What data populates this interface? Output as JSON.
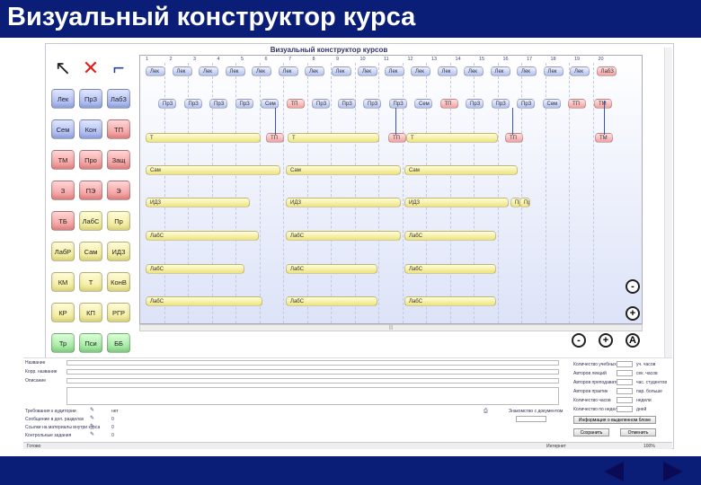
{
  "slide": {
    "title": "Визуальный конструктор курса"
  },
  "window": {
    "title": "Визуальный конструктор курсов"
  },
  "palette": {
    "tools": [
      {
        "icon": "cursor-icon"
      },
      {
        "icon": "delete-x-icon"
      },
      {
        "icon": "link-connector-icon"
      }
    ],
    "rows": [
      [
        {
          "label": "Лек",
          "color": "blue"
        },
        {
          "label": "ПрЗ",
          "color": "blue"
        },
        {
          "label": "ЛабЗ",
          "color": "blue"
        }
      ],
      [
        {
          "label": "Сем",
          "color": "blue"
        },
        {
          "label": "Кон",
          "color": "blue"
        },
        {
          "label": "ТП",
          "color": "red"
        }
      ],
      [
        {
          "label": "ТМ",
          "color": "red"
        },
        {
          "label": "Про",
          "color": "red"
        },
        {
          "label": "Защ",
          "color": "red"
        }
      ],
      [
        {
          "label": "З",
          "color": "red"
        },
        {
          "label": "ПЭ",
          "color": "red"
        },
        {
          "label": "Э",
          "color": "red"
        }
      ],
      [
        {
          "label": "ТБ",
          "color": "red"
        },
        {
          "label": "ЛабС",
          "color": "yellow"
        },
        {
          "label": "Пр",
          "color": "yellow"
        }
      ],
      [
        {
          "label": "ЛабР",
          "color": "yellow"
        },
        {
          "label": "Сам",
          "color": "yellow"
        },
        {
          "label": "ИДЗ",
          "color": "yellow"
        }
      ],
      [
        {
          "label": "КМ",
          "color": "yellow"
        },
        {
          "label": "Т",
          "color": "yellow"
        },
        {
          "label": "КонВ",
          "color": "yellow"
        }
      ],
      [
        {
          "label": "КР",
          "color": "yellow"
        },
        {
          "label": "КП",
          "color": "yellow"
        },
        {
          "label": "РГР",
          "color": "yellow"
        }
      ],
      [
        {
          "label": "Тр",
          "color": "green"
        },
        {
          "label": "Пси",
          "color": "green"
        },
        {
          "label": "ББ",
          "color": "green"
        }
      ]
    ]
  },
  "timeline": {
    "columns": [
      "1",
      "2",
      "3",
      "4",
      "5",
      "6",
      "7",
      "8",
      "9",
      "10",
      "11",
      "12",
      "13",
      "14",
      "15",
      "16",
      "17",
      "18",
      "19",
      "20"
    ],
    "row_lek": [
      "Лек",
      "Лек",
      "Лек",
      "Лек",
      "Лек",
      "Лек",
      "Лек",
      "Лек",
      "Лек",
      "Лек",
      "Лек",
      "Лек",
      "Лек",
      "Лек",
      "Лек",
      "Лек",
      "Лек",
      "ЛабЗ"
    ],
    "row_prz": [
      "ПрЗ",
      "ПрЗ",
      "ПрЗ",
      "ПрЗ",
      "Сем",
      "ТП",
      "ПрЗ",
      "ПрЗ",
      "ПрЗ",
      "ПрЗ",
      "Сем",
      "ТП",
      "ПрЗ",
      "ПрЗ",
      "ПрЗ",
      "Сем",
      "ТП",
      "ТМ"
    ],
    "row_t": [
      "Т",
      "ТП",
      "Т",
      "ТП",
      "Т",
      "ТП",
      "ТМ"
    ],
    "row_sam": [
      "Сам",
      "Сам",
      "Сам"
    ],
    "row_idz": [
      "ИДЗ",
      "ИДЗ",
      "ИДЗ",
      "Пр",
      "Пр"
    ],
    "row_labs1": [
      "ЛабС",
      "ЛабС",
      "ЛабС"
    ],
    "row_labs2": [
      "ЛабС",
      "ЛабС",
      "ЛабС"
    ],
    "row_labs3": [
      "ЛабС",
      "ЛабС",
      "ЛабС"
    ],
    "scroll_label": "|||"
  },
  "zoom": {
    "minus": "-",
    "plus": "+",
    "auto": "A"
  },
  "props": {
    "left_labels": [
      "Название",
      "Корр. название",
      "Описание"
    ],
    "checks": [
      "Требования к аудитории",
      "Сообщение в доп. разделах",
      "Ссылки на материалы внутри курса",
      "Контрольные задания"
    ],
    "check_values": [
      "нет",
      "0",
      "0",
      "0"
    ],
    "right_labels": [
      "Количество учебных недель",
      "Авторов лекций",
      "Авторов преподавателей",
      "Авторов практик",
      "Количество часов",
      "Количество по неделе"
    ],
    "right_values": [
      "",
      "",
      "",
      "",
      "",
      ""
    ],
    "right_units": [
      "уч. часов",
      "сек. часов",
      "час. студентов",
      "пар. больше",
      "недели",
      "дней"
    ],
    "buttons": {
      "apply": "Информация о выделенном блоке",
      "save": "Сохранить",
      "cancel": "Отменить"
    },
    "mid_label": "Знакомство с документом"
  },
  "statusbar": {
    "left": "Готово",
    "center": "Интернет",
    "right": "100%"
  }
}
